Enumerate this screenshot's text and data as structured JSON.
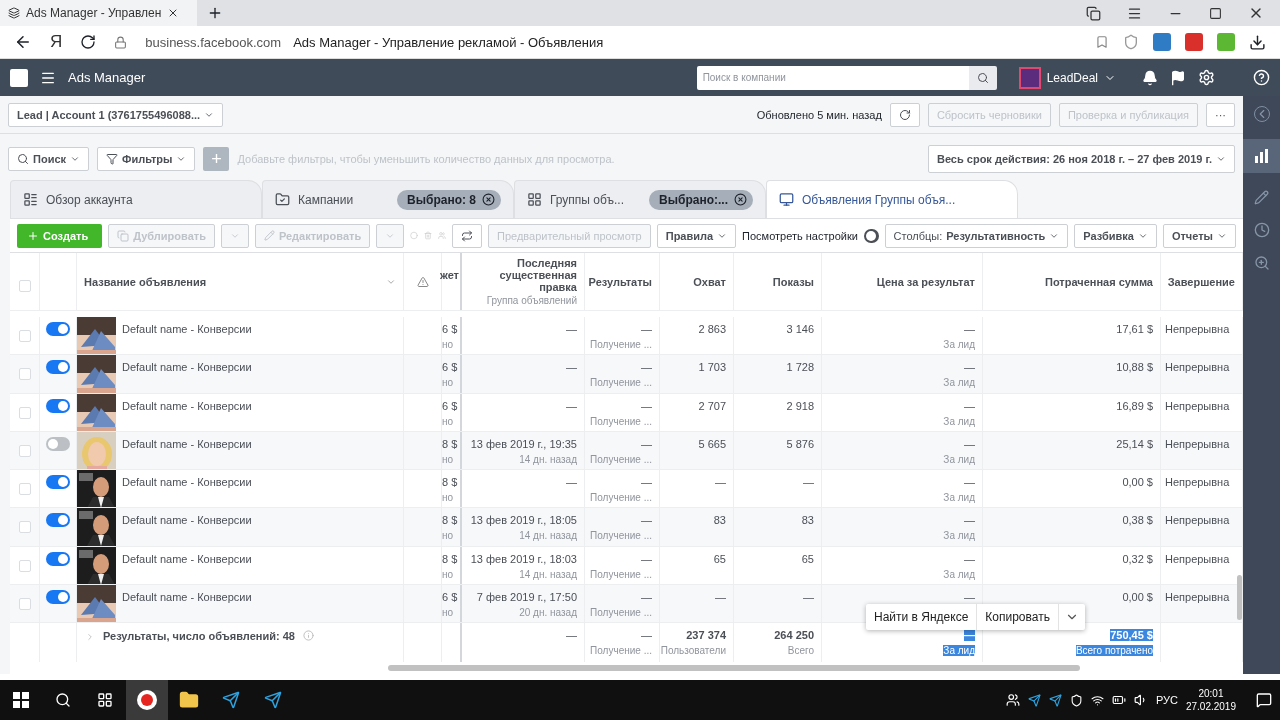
{
  "browser": {
    "tab_title": "Ads Manager - Управлен",
    "logo": "Я",
    "domain": "business.facebook.com",
    "page_title": "Ads Manager - Управление рекламой - Объявления"
  },
  "header": {
    "app": "Ads Manager",
    "search_placeholder": "Поиск в компании",
    "account": "LeadDeal"
  },
  "account_bar": {
    "account": "Lead | Account 1 (3761755496088...",
    "updated": "Обновлено 5 мин. назад",
    "buttons": [
      "Сбросить черновики",
      "Проверка и публикация"
    ],
    "more": "···"
  },
  "filter_bar": {
    "search": "Поиск",
    "filters": "Фильтры",
    "add": "+",
    "hint": "Добавьте фильтры, чтобы уменьшить количество данных для просмотра.",
    "date_range": "Весь срок действия: 26 ноя 2018 г. – 27 фев 2019 г."
  },
  "tabs": [
    {
      "label": "Обзор аккаунта",
      "selected": false
    },
    {
      "label": "Кампании",
      "selected": false,
      "chip": "Выбрано: 8"
    },
    {
      "label": "Группы объ...",
      "selected": false,
      "chip": "Выбрано:..."
    },
    {
      "label": "Объявления Группы объя...",
      "selected": true
    }
  ],
  "toolbar": {
    "create": "Создать",
    "duplicate": "Дублировать",
    "edit": "Редактировать",
    "preview": "Предварительный просмотр",
    "rules": "Правила",
    "view_settings": {
      "label": "Посмотреть настройки",
      "on": false
    },
    "columns": {
      "label": "Столбцы:",
      "value": "Результативность"
    },
    "breakdown": "Разбивка",
    "reports": "Отчеты"
  },
  "table": {
    "select_all": {
      "checked": false
    },
    "columns": [
      {
        "label": "Название объявления"
      },
      {
        "label": "жет"
      },
      {
        "label": "Последняя существенная правка",
        "sub": "Группа объявлений"
      },
      {
        "label": "Результаты"
      },
      {
        "label": "Охват"
      },
      {
        "label": "Показы"
      },
      {
        "label": "Цена за результат"
      },
      {
        "label": "Потраченная сумма"
      },
      {
        "label": "Завершение"
      }
    ],
    "rows": [
      {
        "checked": false,
        "active": true,
        "name": "Default name - Конверсии",
        "budget": "6 $",
        "budget_sub": "но",
        "last_edit": "—",
        "results": "—",
        "results_sub": "Получение ...",
        "reach": "2 863",
        "impressions": "3 146",
        "cost": "—",
        "cost_sub": "За лид",
        "spent": "17,61 $",
        "end": "Непрерывна"
      },
      {
        "checked": false,
        "active": true,
        "name": "Default name - Конверсии",
        "budget": "6 $",
        "budget_sub": "но",
        "last_edit": "—",
        "results": "—",
        "results_sub": "Получение ...",
        "reach": "1 703",
        "impressions": "1 728",
        "cost": "—",
        "cost_sub": "За лид",
        "spent": "10,88 $",
        "end": "Непрерывна"
      },
      {
        "checked": false,
        "active": true,
        "name": "Default name - Конверсии",
        "budget": "6 $",
        "budget_sub": "но",
        "last_edit": "—",
        "results": "—",
        "results_sub": "Получение ...",
        "reach": "2 707",
        "impressions": "2 918",
        "cost": "—",
        "cost_sub": "За лид",
        "spent": "16,89 $",
        "end": "Непрерывна"
      },
      {
        "checked": false,
        "active": false,
        "name": "Default name - Конверсии",
        "budget": "8 $",
        "budget_sub": "но",
        "last_edit": "13 фев 2019 г., 19:35",
        "last_edit_sub": "14 дн. назад",
        "results": "—",
        "results_sub": "Получение ...",
        "reach": "5 665",
        "impressions": "5 876",
        "cost": "—",
        "cost_sub": "За лид",
        "spent": "25,14 $",
        "end": "Непрерывна"
      },
      {
        "checked": false,
        "active": true,
        "name": "Default name - Конверсии",
        "budget": "8 $",
        "budget_sub": "но",
        "last_edit": "—",
        "results": "—",
        "results_sub": "Получение ...",
        "reach": "—",
        "impressions": "—",
        "cost": "—",
        "cost_sub": "За лид",
        "spent": "0,00 $",
        "end": "Непрерывна"
      },
      {
        "checked": false,
        "active": true,
        "name": "Default name - Конверсии",
        "budget": "8 $",
        "budget_sub": "но",
        "last_edit": "13 фев 2019 г., 18:05",
        "last_edit_sub": "14 дн. назад",
        "results": "—",
        "results_sub": "Получение ...",
        "reach": "83",
        "impressions": "83",
        "cost": "—",
        "cost_sub": "За лид",
        "spent": "0,38 $",
        "end": "Непрерывна"
      },
      {
        "checked": false,
        "active": true,
        "name": "Default name - Конверсии",
        "budget": "8 $",
        "budget_sub": "но",
        "last_edit": "13 фев 2019 г., 18:03",
        "last_edit_sub": "14 дн. назад",
        "results": "—",
        "results_sub": "Получение ...",
        "reach": "65",
        "impressions": "65",
        "cost": "—",
        "cost_sub": "За лид",
        "spent": "0,32 $",
        "end": "Непрерывна"
      },
      {
        "checked": false,
        "active": true,
        "name": "Default name - Конверсии",
        "budget": "6 $",
        "budget_sub": "но",
        "last_edit": "7 фев 2019 г., 17:50",
        "last_edit_sub": "20 дн. назад",
        "results": "—",
        "results_sub": "Получение ...",
        "reach": "—",
        "impressions": "—",
        "cost": "—",
        "spent": "0,00 $",
        "end": "Непрерывна"
      }
    ],
    "footer": {
      "label": "Результаты, число объявлений: 48",
      "last_edit": "—",
      "results": "—",
      "results_sub": "Получение ...",
      "reach": "237 374",
      "reach_sub": "Пользователи",
      "impressions": "264 250",
      "impressions_sub": "Всего",
      "cost": "—",
      "cost_sub": "За лид",
      "cost_highlighted": true,
      "spent": "750,45 $",
      "spent_sub": "Всего потрачено",
      "spent_highlighted": true
    }
  },
  "context_menu": {
    "items": [
      "Найти в Яндексе",
      "Копировать"
    ]
  },
  "taskbar": {
    "language": "РУС",
    "time": "20:01",
    "date": "27.02.2019"
  }
}
